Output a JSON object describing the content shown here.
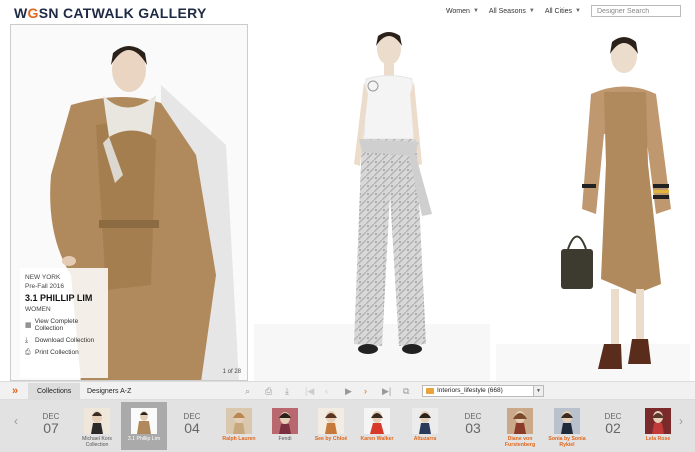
{
  "header": {
    "logo_w": "W",
    "logo_g": "G",
    "logo_sn": "SN",
    "logo_rest": " CATWALK GALLERY",
    "filters": [
      "Women",
      "All Seasons",
      "All Cities"
    ],
    "search_placeholder": "Designer Search"
  },
  "look_info": {
    "city": "NEW YORK",
    "season": "Pre-Fall 2016",
    "designer": "3.1 PHILLIP LIM",
    "gender": "WOMEN",
    "actions": [
      "View Complete Collection",
      "Download Collection",
      "Print Collection"
    ],
    "counter": "1 of 28"
  },
  "toolbar": {
    "tabs": [
      "Collections",
      "Designers A-Z"
    ],
    "folder": "Interiors_lifestyle (668)"
  },
  "filmstrip": [
    {
      "type": "date",
      "month": "DEC",
      "day": "07"
    },
    {
      "type": "designer",
      "label": "Michael Kors Collection",
      "style": "grey"
    },
    {
      "type": "designer",
      "label": "3.1 Phillip Lim",
      "style": "selected"
    },
    {
      "type": "date",
      "month": "DEC",
      "day": "04"
    },
    {
      "type": "designer",
      "label": "Ralph Lauren",
      "style": "orange"
    },
    {
      "type": "designer",
      "label": "Fendi",
      "style": "grey"
    },
    {
      "type": "designer",
      "label": "See by Chloé",
      "style": "orange"
    },
    {
      "type": "designer",
      "label": "Karen Walker",
      "style": "orange"
    },
    {
      "type": "designer",
      "label": "Altuzarra",
      "style": "orange"
    },
    {
      "type": "date",
      "month": "DEC",
      "day": "03"
    },
    {
      "type": "designer",
      "label": "Diane von Furstenberg",
      "style": "orange"
    },
    {
      "type": "designer",
      "label": "Sonia by Sonia Rykiel",
      "style": "orange"
    },
    {
      "type": "date",
      "month": "DEC",
      "day": "02"
    },
    {
      "type": "designer",
      "label": "Lela Rose",
      "style": "orange"
    }
  ],
  "colors": {
    "accent": "#e2661c",
    "navy": "#1f2a44",
    "camel": "#b08a5c"
  }
}
